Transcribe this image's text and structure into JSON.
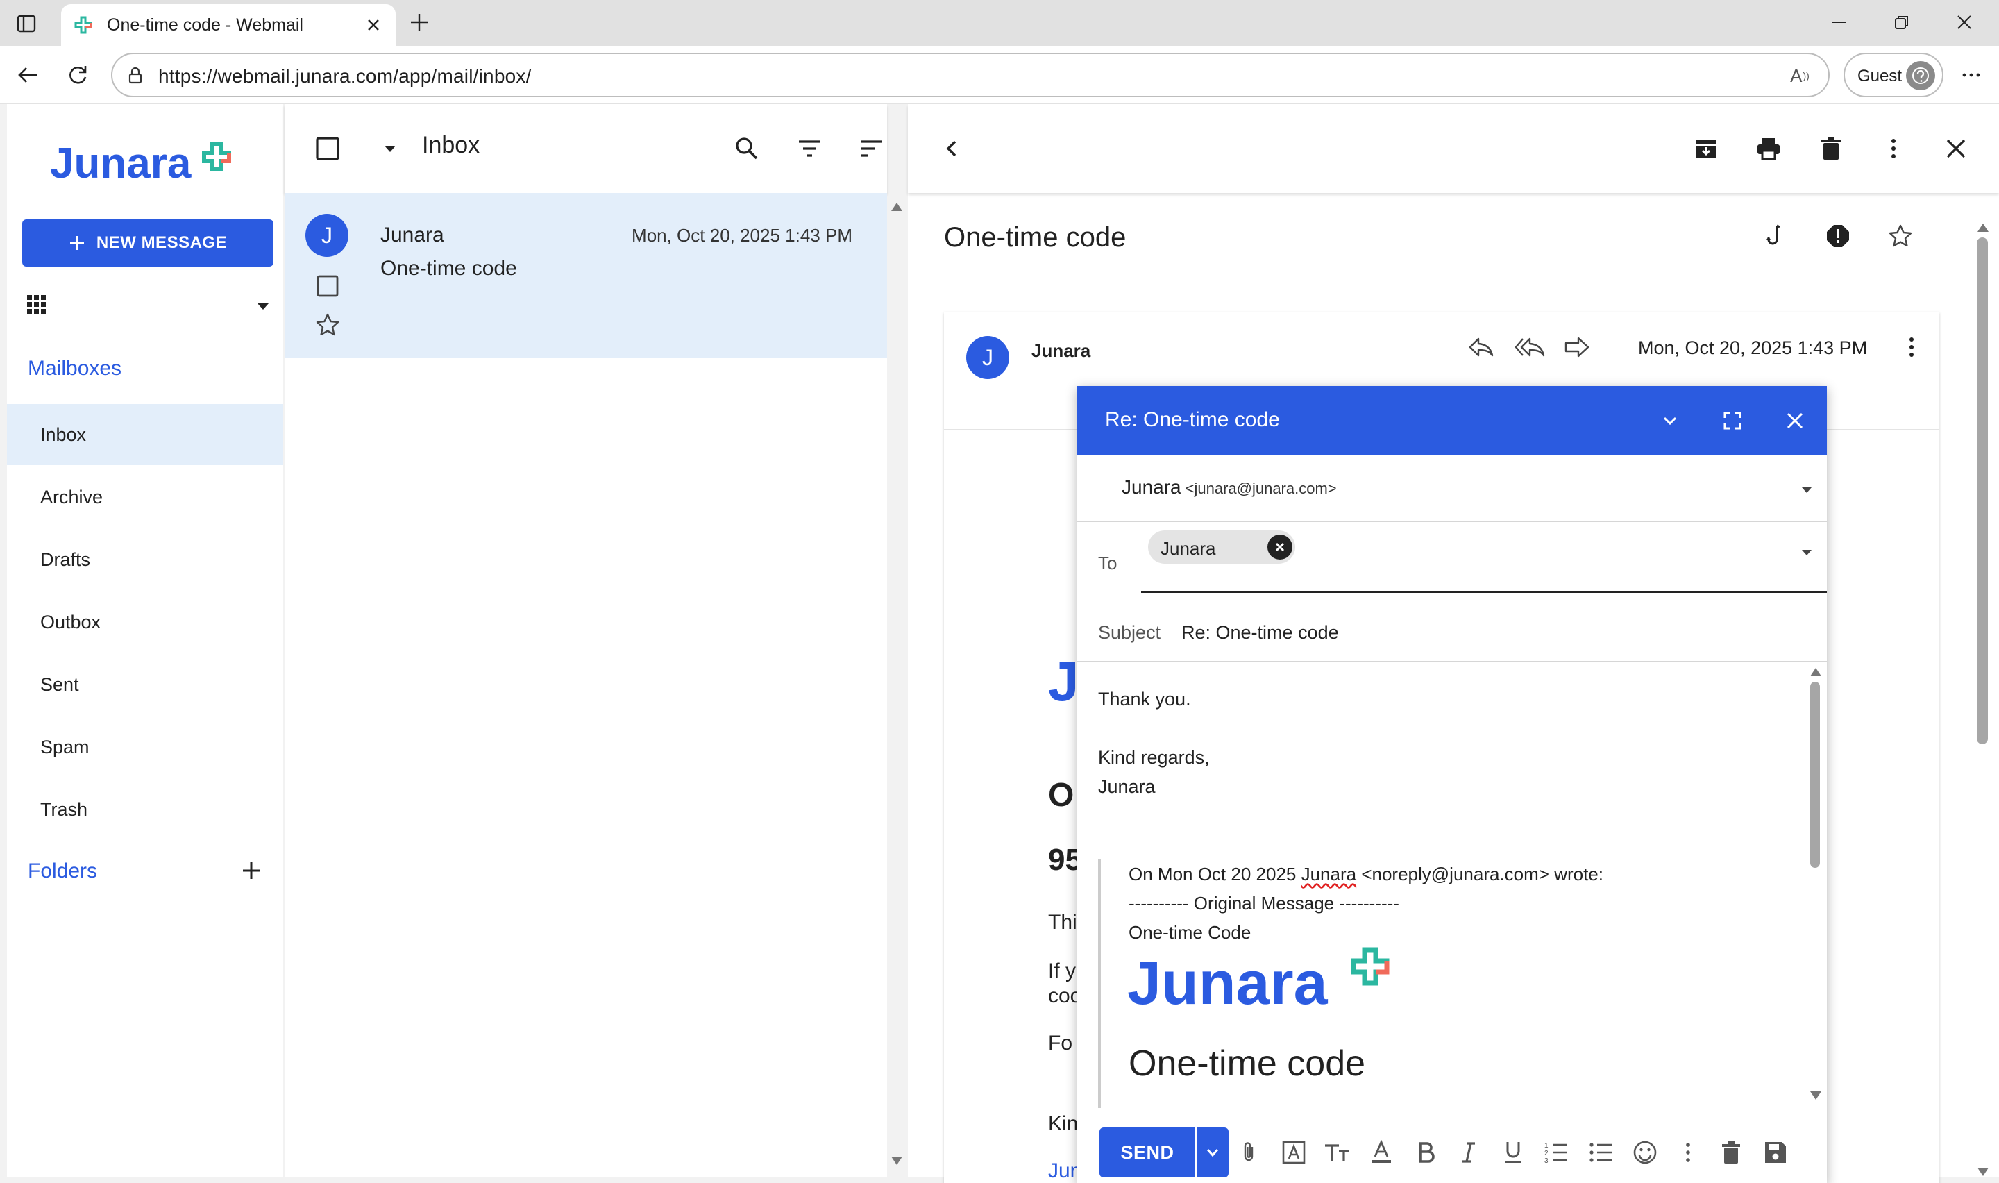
{
  "browser": {
    "tab_title": "One-time code - Webmail",
    "url": "https://webmail.junara.com/app/mail/inbox/",
    "profile_label": "Guest",
    "read_aloud_glyph": "A"
  },
  "nav": {
    "brand": "Junara",
    "new_message_label": "NEW MESSAGE",
    "mailboxes_label": "Mailboxes",
    "mailboxes": [
      {
        "label": "Inbox"
      },
      {
        "label": "Archive"
      },
      {
        "label": "Drafts"
      },
      {
        "label": "Outbox"
      },
      {
        "label": "Sent"
      },
      {
        "label": "Spam"
      },
      {
        "label": "Trash"
      }
    ],
    "folders_label": "Folders"
  },
  "list": {
    "title": "Inbox",
    "messages": [
      {
        "avatar": "J",
        "from": "Junara",
        "subject": "One-time code",
        "date": "Mon, Oct 20, 2025 1:43 PM"
      }
    ]
  },
  "reader": {
    "subject": "One-time code",
    "avatar": "J",
    "from": "Junara",
    "date": "Mon, Oct 20, 2025 1:43 PM",
    "peek": [
      "J",
      "O",
      "95",
      "Thi",
      "If y",
      "coo",
      "Fo",
      "Kin",
      "Jun"
    ]
  },
  "compose": {
    "title": "Re: One-time code",
    "from_name": "Junara",
    "from_addr": "<junara@junara.com>",
    "to_label": "To",
    "to_chip": "Junara",
    "subject_label": "Subject",
    "subject_value": "Re: One-time code",
    "body_lines": [
      "Thank you.",
      "Kind regards,",
      "Junara"
    ],
    "quote_header_prefix": "On Mon Oct 20 2025 ",
    "quote_header_name": "Junara",
    "quote_header_suffix": " <noreply@junara.com> wrote:",
    "quote_lines": [
      "---------- Original Message ----------",
      "One-time Code"
    ],
    "quote_brand": "Junara",
    "quote_heading": "One-time code",
    "send_label": "SEND"
  },
  "colors": {
    "accent": "#2b5be0",
    "selected_row": "#e3eefa",
    "logo_teal": "#2bb7a0",
    "logo_coral": "#f06a5a"
  }
}
